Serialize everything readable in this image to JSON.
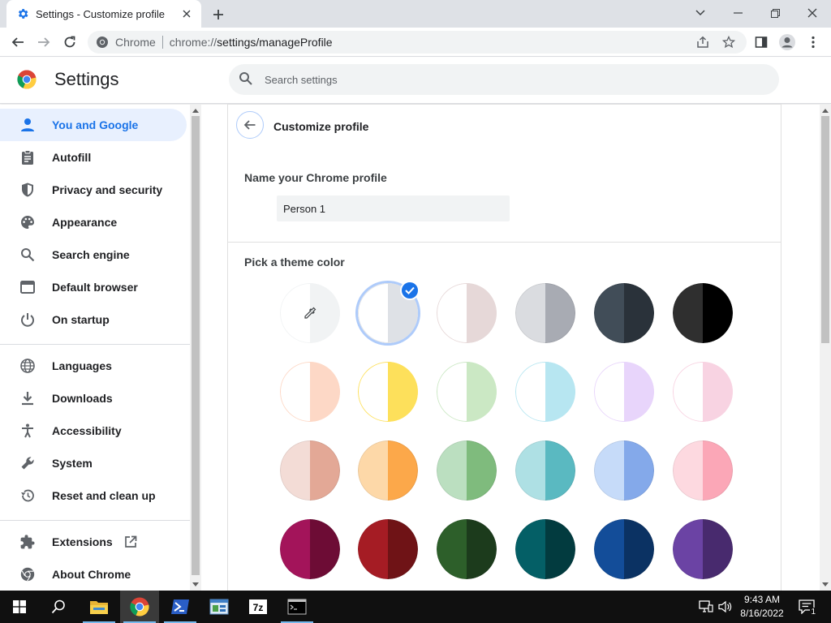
{
  "browser": {
    "tab_title": "Settings - Customize profile",
    "omnibox_site": "Chrome",
    "omnibox_url_scheme": "chrome://",
    "omnibox_url_path": "settings/manageProfile"
  },
  "header": {
    "title": "Settings",
    "search_placeholder": "Search settings"
  },
  "sidebar": {
    "items": [
      {
        "label": "You and Google",
        "icon": "person-icon",
        "active": true
      },
      {
        "label": "Autofill",
        "icon": "clipboard-icon"
      },
      {
        "label": "Privacy and security",
        "icon": "shield-icon"
      },
      {
        "label": "Appearance",
        "icon": "palette-icon"
      },
      {
        "label": "Search engine",
        "icon": "search-icon"
      },
      {
        "label": "Default browser",
        "icon": "browser-window-icon"
      },
      {
        "label": "On startup",
        "icon": "power-icon"
      },
      {
        "label": "Languages",
        "icon": "globe-icon"
      },
      {
        "label": "Downloads",
        "icon": "download-icon"
      },
      {
        "label": "Accessibility",
        "icon": "accessibility-icon"
      },
      {
        "label": "System",
        "icon": "wrench-icon"
      },
      {
        "label": "Reset and clean up",
        "icon": "restore-icon"
      },
      {
        "label": "Extensions",
        "icon": "puzzle-icon"
      },
      {
        "label": "About Chrome",
        "icon": "chrome-icon"
      }
    ]
  },
  "page": {
    "title": "Customize profile",
    "name_label": "Name your Chrome profile",
    "name_value": "Person 1",
    "theme_label": "Pick a theme color"
  },
  "theme_colors": [
    [
      "#ffffff",
      "#f1f3f4"
    ],
    [
      "#ffffff",
      "#dee1e6"
    ],
    [
      "#ffffff",
      "#e6d8d8"
    ],
    [
      "#dadce0",
      "#a8abb3"
    ],
    [
      "#414d58",
      "#2a323a"
    ],
    [
      "#2f2f2f",
      "#000000"
    ],
    [
      "#ffffff",
      "#fdd8c6"
    ],
    [
      "#ffffff",
      "#fde05b"
    ],
    [
      "#ffffff",
      "#cbe8c4"
    ],
    [
      "#ffffff",
      "#b7e6f1"
    ],
    [
      "#ffffff",
      "#e8d5fb"
    ],
    [
      "#ffffff",
      "#f8d3e2"
    ],
    [
      "#f3dcd6",
      "#e3a896"
    ],
    [
      "#fdd8a8",
      "#fca84a"
    ],
    [
      "#bbdfc0",
      "#7fbb7d"
    ],
    [
      "#aee0e4",
      "#5ab9c1"
    ],
    [
      "#c6dbf9",
      "#84a9ea"
    ],
    [
      "#fdd9e0",
      "#fba7b7"
    ],
    [
      "#a3145a",
      "#6d0c35"
    ],
    [
      "#a51c24",
      "#6f1316"
    ],
    [
      "#2d5f2a",
      "#1c3b1c"
    ],
    [
      "#045f66",
      "#023b3f"
    ],
    [
      "#134d99",
      "#0b3263"
    ],
    [
      "#6b43a4",
      "#482a6e"
    ]
  ],
  "selected_theme_index": 1,
  "taskbar": {
    "time": "9:43 AM",
    "date": "8/16/2022",
    "notification_count": "1"
  }
}
